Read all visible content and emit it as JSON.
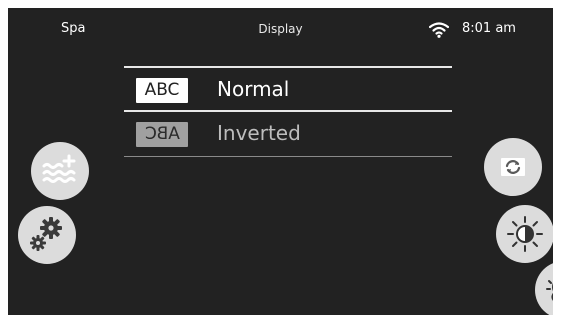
{
  "statusbar": {
    "left_label": "Spa",
    "title": "Display",
    "wifi_icon": "wifi-icon",
    "time": "8:01 am"
  },
  "options": [
    {
      "badge": "ABC",
      "label": "Normal",
      "selected": true
    },
    {
      "badge": "ABC",
      "label": "Inverted",
      "selected": false
    }
  ],
  "side_buttons": {
    "left": [
      "water-heat-icon",
      "settings-gears-icon"
    ],
    "right": [
      "flip-screen-icon",
      "brightness-icon",
      "weather-icon"
    ]
  },
  "colors": {
    "background": "#222222",
    "button_fill": "#dcdcdc",
    "icon": "#555555",
    "text": "#ffffff"
  }
}
